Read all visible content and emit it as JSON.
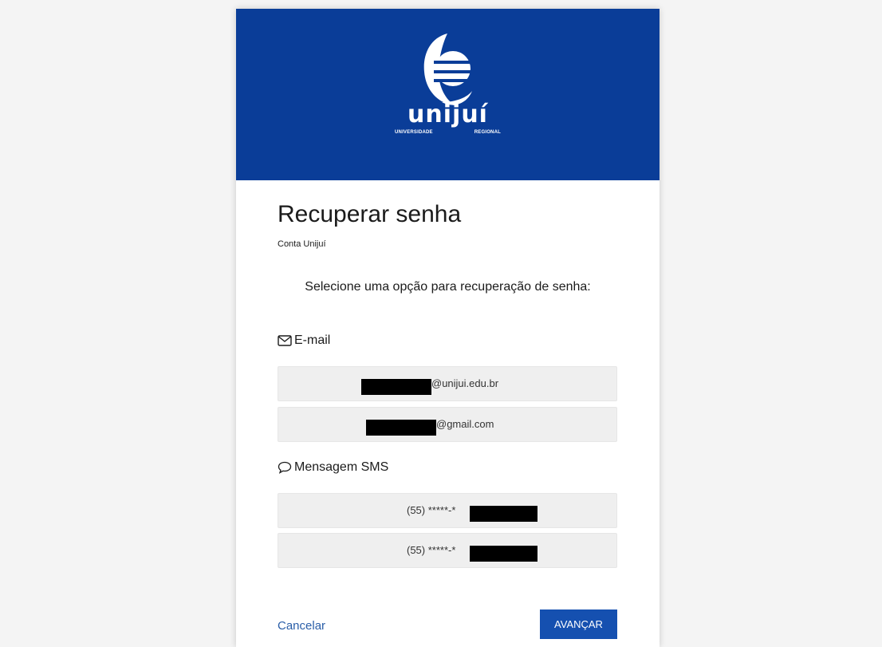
{
  "header": {
    "logo_wordmark": "unijuí",
    "logo_sub_left": "UNIVERSIDADE",
    "logo_sub_right": "REGIONAL",
    "banner_color": "#0a3d98"
  },
  "page": {
    "title": "Recuperar senha",
    "subtitle": "Conta Unijuí",
    "instruction": "Selecione uma opção para recuperação de senha:"
  },
  "email_section": {
    "label": "E-mail",
    "icon": "envelope-icon",
    "options": [
      {
        "value": "@unijui.edu.br",
        "redacted": true
      },
      {
        "value": "@gmail.com",
        "redacted": true
      }
    ]
  },
  "sms_section": {
    "label": "Mensagem SMS",
    "icon": "speech-bubble-icon",
    "options": [
      {
        "value": "(55) *****-*",
        "redacted": true
      },
      {
        "value": "(55) *****-*",
        "redacted": true
      }
    ]
  },
  "actions": {
    "cancel_label": "Cancelar",
    "advance_label": "AVANÇAR",
    "link_color": "#2a5ea8",
    "button_color": "#1550b0"
  }
}
